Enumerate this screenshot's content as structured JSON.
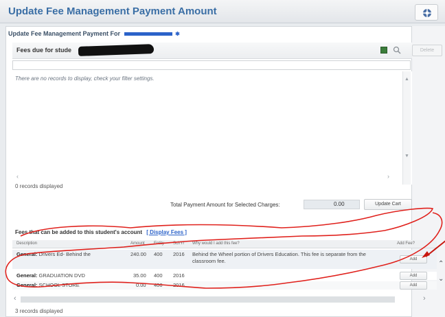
{
  "window": {
    "title": "Update Fee Management Payment Amount"
  },
  "header": {
    "subtitle": "Update Fee Management Payment For",
    "help_icon": "help-lifebuoy-icon"
  },
  "fees_due": {
    "label": "Fees due for stude",
    "empty_message": "There are no records to display, check your filter settings.",
    "record_count": "0 records displayed",
    "toolbar_disabled_label": "Delete"
  },
  "totals": {
    "label": "Total Payment Amount for Selected Charges:",
    "value": "0.00",
    "update_cart": "Update Cart"
  },
  "fees_addable": {
    "title": "Fees that can be added to this student's account",
    "link": "[ Display Fees ]",
    "columns": [
      "Description",
      "Amount",
      "Entity",
      "SchYr",
      "Why would I add this fee?",
      "Add Fee?"
    ],
    "rows": [
      {
        "category": "General:",
        "name": "Drivers Ed- Behind the",
        "amount": "240.00",
        "entity": "400",
        "year": "2016",
        "why": "Behind the Wheel portion of Drivers Education. This fee is separate from the classroom fee.",
        "add": "Add"
      },
      {
        "category": "General:",
        "name": "GRADUATION DVD",
        "amount": "35.00",
        "entity": "400",
        "year": "2016",
        "why": "",
        "add": "Add"
      },
      {
        "category": "General:",
        "name": "SCHOOL STORE",
        "amount": "0.00",
        "entity": "400",
        "year": "2016",
        "why": "",
        "add": "Add"
      }
    ],
    "record_count": "3 records displayed"
  },
  "colors": {
    "title": "#3a6ea5",
    "link": "#2b62c9",
    "annotation": "#e0201b"
  }
}
